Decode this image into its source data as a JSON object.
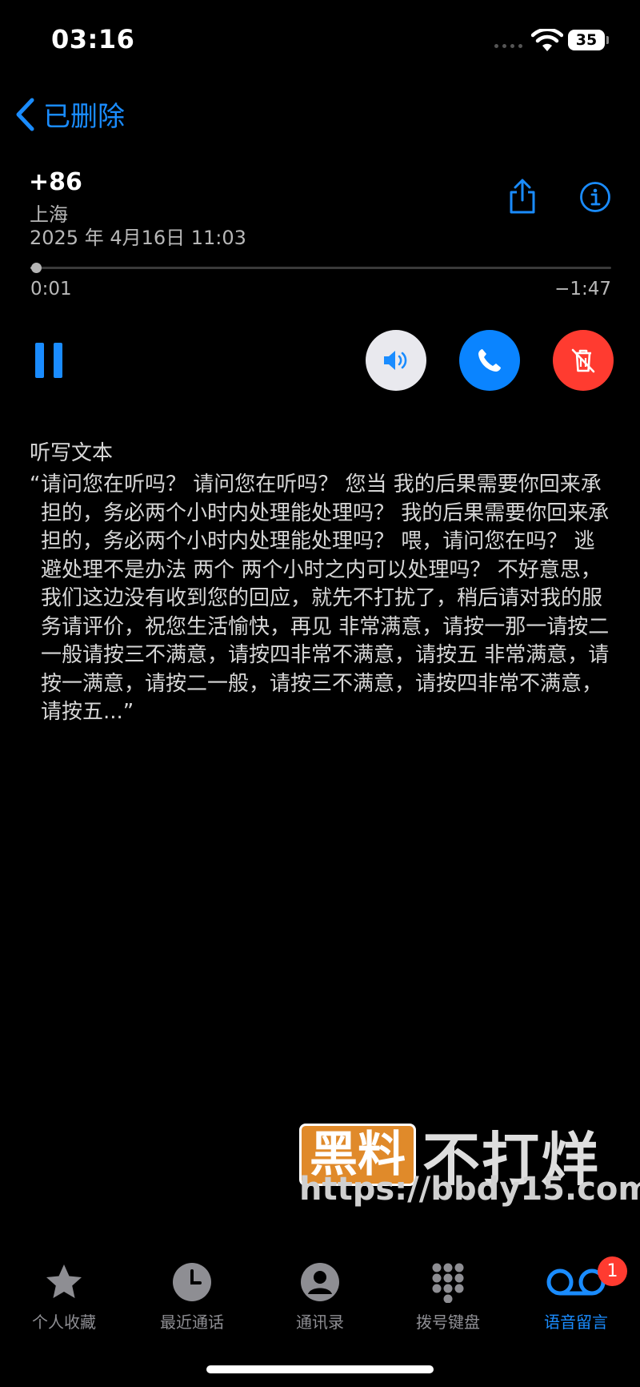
{
  "status_bar": {
    "time": "03:16",
    "battery": "35"
  },
  "nav": {
    "back_label": "已删除"
  },
  "voicemail": {
    "number": "+86",
    "location": "上海",
    "datetime": "2025 年 4月16日 11:03",
    "elapsed": "0:01",
    "remaining": "−1:47",
    "progress_fraction": 0.01
  },
  "transcript": {
    "label": "听写文本",
    "open_quote": "“",
    "text": "请问您在听吗？ 请问您在听吗？ 您当 我的后果需要你回来承担的，务必两个小时内处理能处理吗？ 我的后果需要你回来承担的，务必两个小时内处理能处理吗？ 喂，请问您在吗？ 逃避处理不是办法 两个 两个小时之内可以处理吗？ 不好意思，我们这边没有收到您的回应，就先不打扰了，稍后请对我的服务请评价，祝您生活愉快，再见 非常满意，请按一那一请按二一般请按三不满意，请按四非常不满意，请按五 非常满意，请按一满意，请按二一般，请按三不满意，请按四非常不满意，请按五...”"
  },
  "watermark": {
    "box_text": "黑料",
    "brand_text": "不打烊",
    "url": "https://bbdy15.com"
  },
  "tabs": [
    {
      "label": "个人收藏",
      "icon": "star-icon"
    },
    {
      "label": "最近通话",
      "icon": "clock-icon"
    },
    {
      "label": "通讯录",
      "icon": "person-icon"
    },
    {
      "label": "拨号键盘",
      "icon": "keypad-icon"
    },
    {
      "label": "语音留言",
      "icon": "voicemail-icon"
    }
  ],
  "badge": {
    "count": "1"
  },
  "colors": {
    "accent": "#1a8cff",
    "delete": "#ff3b30",
    "call": "#0a84ff",
    "watermark": "#e08a2a"
  }
}
